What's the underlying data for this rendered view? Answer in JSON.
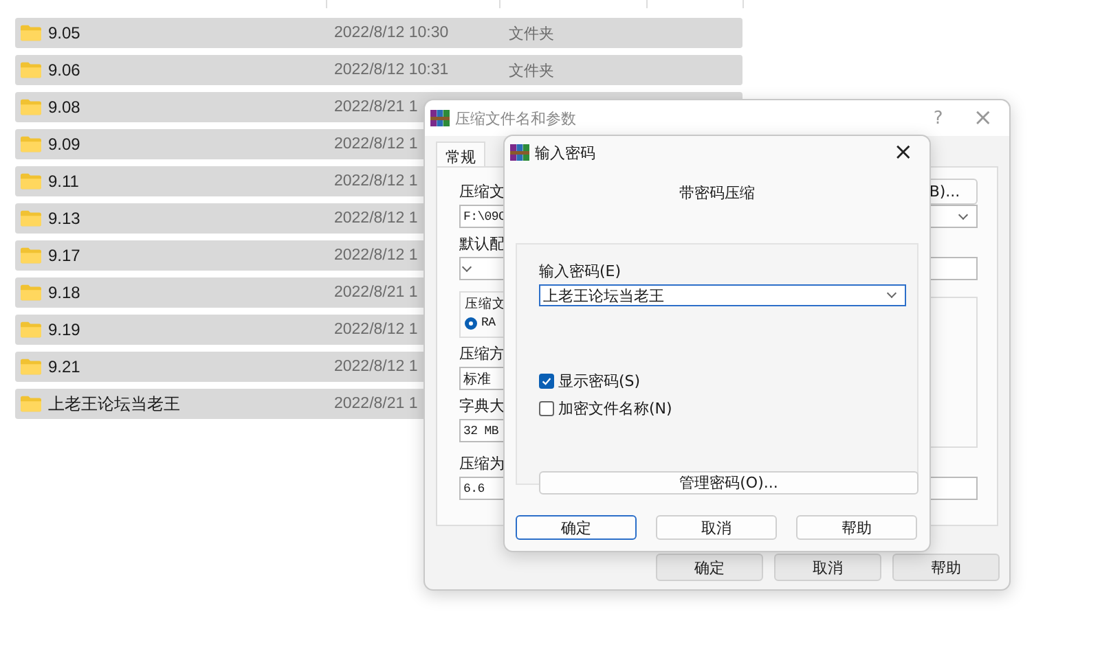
{
  "file_list": {
    "rows": [
      {
        "name": "9.05",
        "date": "2022/8/12 10:30",
        "type": "文件夹"
      },
      {
        "name": "9.06",
        "date": "2022/8/12 10:31",
        "type": "文件夹"
      },
      {
        "name": "9.08",
        "date": "2022/8/21 1"
      },
      {
        "name": "9.09",
        "date": "2022/8/12 1"
      },
      {
        "name": "9.11",
        "date": "2022/8/12 1"
      },
      {
        "name": "9.13",
        "date": "2022/8/12 1"
      },
      {
        "name": "9.17",
        "date": "2022/8/12 1"
      },
      {
        "name": "9.18",
        "date": "2022/8/21 1"
      },
      {
        "name": "9.19",
        "date": "2022/8/12 1"
      },
      {
        "name": "9.21",
        "date": "2022/8/12 1"
      },
      {
        "name": "上老王论坛当老王",
        "date": "2022/8/21 1"
      }
    ]
  },
  "compress_dialog": {
    "title": "压缩文件名和参数",
    "help_glyph": "?",
    "close_glyph": "×",
    "tabs": [
      {
        "label": "常规",
        "selected": true
      }
    ],
    "archive_name_label": "压缩文",
    "browse_button": "B)...",
    "archive_name_value": "F:\\09C",
    "profile_label": "默认配",
    "format_group": {
      "legend": "压缩文",
      "options": [
        {
          "label": "RA",
          "selected": true
        }
      ]
    },
    "method_label": "压缩方",
    "method_value": "标准",
    "dictionary_label": "字典大",
    "dictionary_value": "32 MB",
    "split_label": "压缩为",
    "split_value": "6.6",
    "buttons": [
      {
        "label": "确定",
        "focused": false
      },
      {
        "label": "取消",
        "focused": false
      },
      {
        "label": "帮助",
        "focused": false
      }
    ]
  },
  "password_dialog": {
    "title": "输入密码",
    "close_glyph": "×",
    "heading": "带密码压缩",
    "password_label": "输入密码(E)",
    "password_value": "上老王论坛当老王",
    "checkboxes": [
      {
        "label": "显示密码(S)",
        "checked": true
      },
      {
        "label": "加密文件名称(N)",
        "checked": false
      }
    ],
    "manage_button": "管理密码(O)...",
    "buttons": [
      {
        "label": "确定",
        "focused": true
      },
      {
        "label": "取消",
        "focused": false
      },
      {
        "label": "帮助",
        "focused": false
      }
    ]
  }
}
